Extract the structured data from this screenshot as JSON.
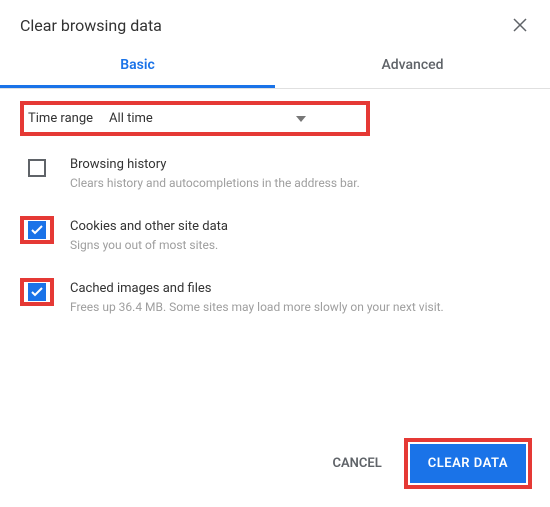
{
  "dialog": {
    "title": "Clear browsing data"
  },
  "tabs": {
    "basic": "Basic",
    "advanced": "Advanced"
  },
  "timeRange": {
    "label": "Time range",
    "value": "All time"
  },
  "options": {
    "browsingHistory": {
      "title": "Browsing history",
      "desc": "Clears history and autocompletions in the address bar.",
      "checked": false
    },
    "cookies": {
      "title": "Cookies and other site data",
      "desc": "Signs you out of most sites.",
      "checked": true
    },
    "cache": {
      "title": "Cached images and files",
      "desc": "Frees up 36.4 MB. Some sites may load more slowly on your next visit.",
      "checked": true
    }
  },
  "buttons": {
    "cancel": "CANCEL",
    "clear": "CLEAR DATA"
  }
}
